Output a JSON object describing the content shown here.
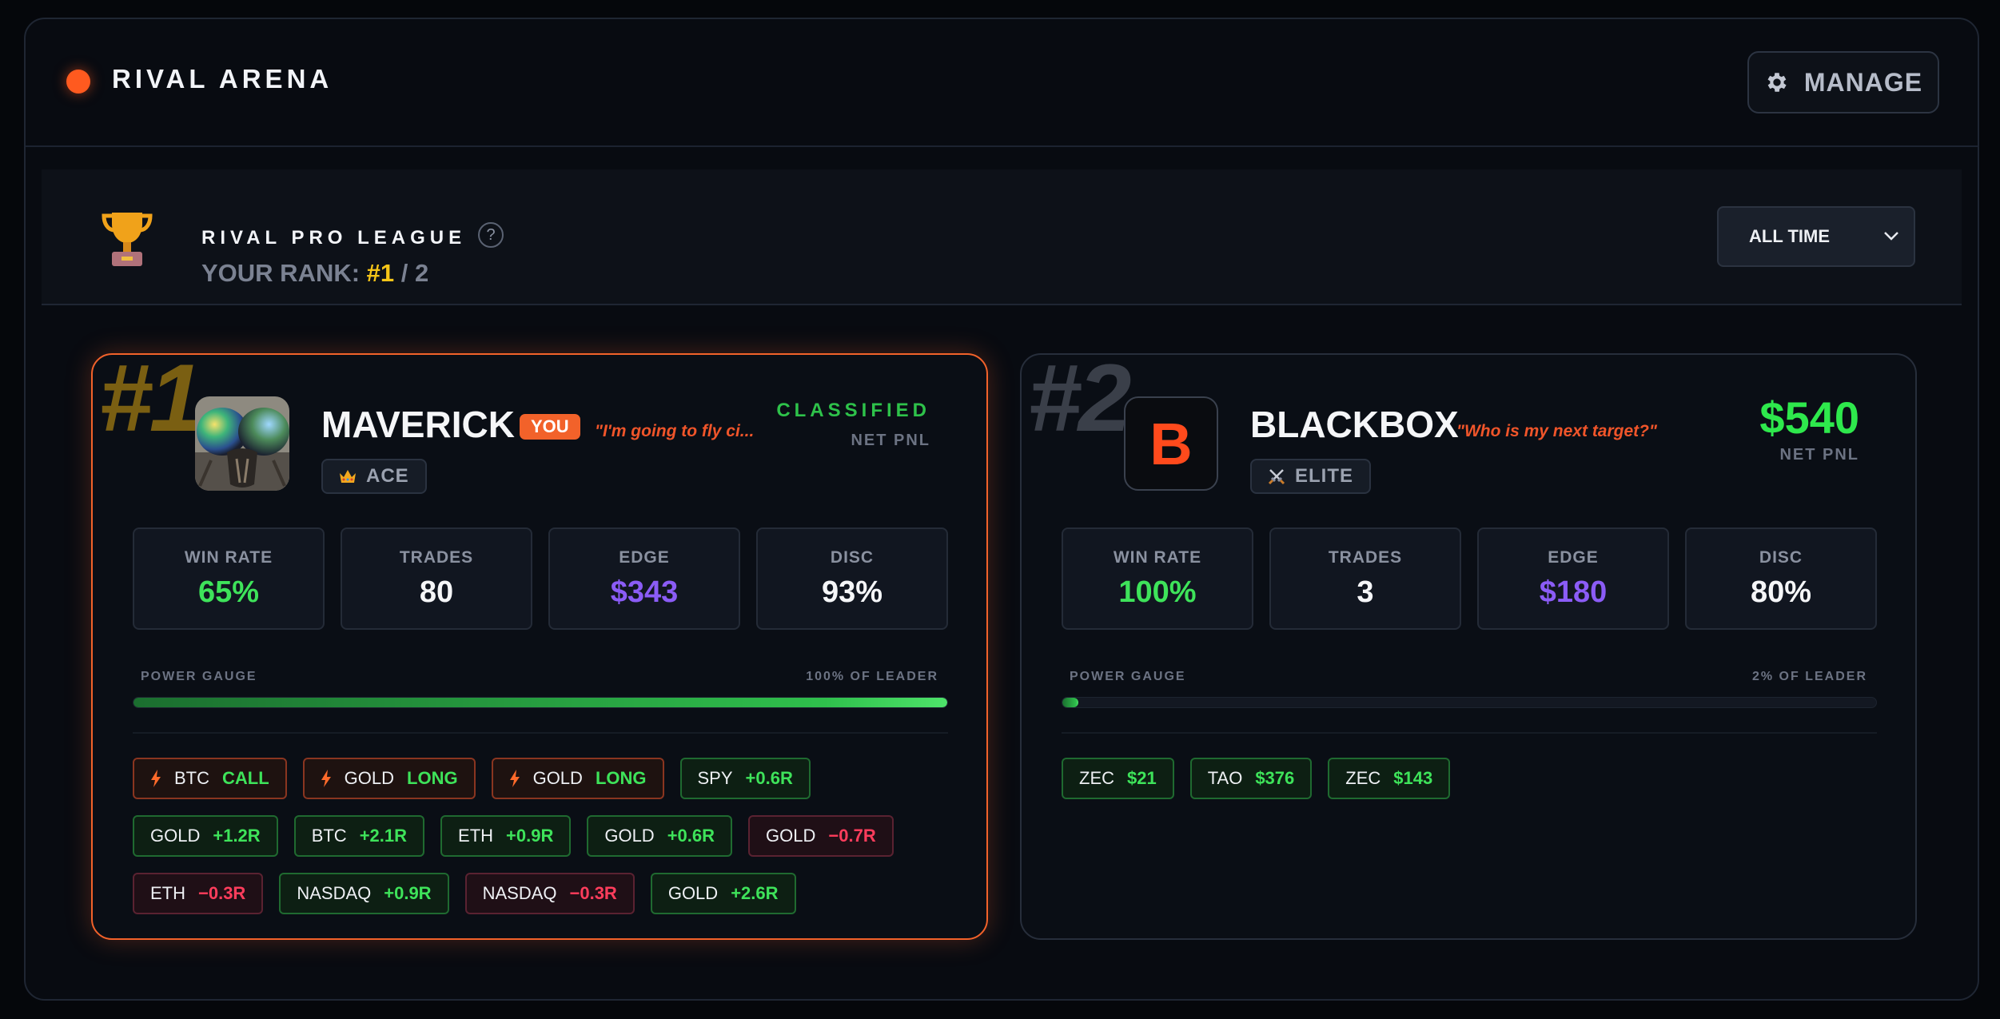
{
  "header": {
    "title": "RIVAL ARENA",
    "manage_label": "MANAGE"
  },
  "league": {
    "name": "RIVAL PRO LEAGUE",
    "help": "?",
    "rank_prefix": "YOUR RANK: ",
    "rank": "#1",
    "rank_total": " / 2",
    "time_filter": "ALL TIME"
  },
  "colors": {
    "accent": "#f2622a",
    "positive": "#3ee35a",
    "negative": "#ff3d5c",
    "edge": "#8b5cf6",
    "rank": "#f5c518"
  },
  "cards": [
    {
      "rank": "#1",
      "name": "MAVERICK",
      "you_badge": "YOU",
      "quote": "\"I'm going to fly ci...",
      "tier": "ACE",
      "tier_icon": "crown-icon",
      "pnl": "CLASSIFIED",
      "pnl_label": "NET PNL",
      "stats": [
        {
          "label": "WIN RATE",
          "value": "65%"
        },
        {
          "label": "TRADES",
          "value": "80"
        },
        {
          "label": "EDGE",
          "value": "$343"
        },
        {
          "label": "DISC",
          "value": "93%"
        }
      ],
      "gauge_label": "POWER GAUGE",
      "gauge_pct_label": "100% OF LEADER",
      "gauge_value": 100,
      "live_positions": [
        {
          "symbol": "BTC",
          "result": "CALL"
        },
        {
          "symbol": "GOLD",
          "result": "LONG"
        },
        {
          "symbol": "GOLD",
          "result": "LONG"
        }
      ],
      "trades": [
        {
          "symbol": "SPY",
          "result": "+0.6R",
          "type": "pos"
        },
        {
          "symbol": "GOLD",
          "result": "+1.2R",
          "type": "pos"
        },
        {
          "symbol": "BTC",
          "result": "+2.1R",
          "type": "pos"
        },
        {
          "symbol": "ETH",
          "result": "+0.9R",
          "type": "pos"
        },
        {
          "symbol": "GOLD",
          "result": "+0.6R",
          "type": "pos"
        },
        {
          "symbol": "GOLD",
          "result": "−0.7R",
          "type": "neg"
        },
        {
          "symbol": "ETH",
          "result": "−0.3R",
          "type": "neg"
        },
        {
          "symbol": "NASDAQ",
          "result": "+0.9R",
          "type": "pos"
        },
        {
          "symbol": "NASDAQ",
          "result": "−0.3R",
          "type": "neg"
        },
        {
          "symbol": "GOLD",
          "result": "+2.6R",
          "type": "pos"
        }
      ]
    },
    {
      "rank": "#2",
      "name": "BLACKBOX",
      "avatar_letter": "B",
      "quote": "\"Who is my next target?\"",
      "tier": "ELITE",
      "tier_icon": "crossed-swords-icon",
      "pnl": "$540",
      "pnl_label": "NET PNL",
      "stats": [
        {
          "label": "WIN RATE",
          "value": "100%"
        },
        {
          "label": "TRADES",
          "value": "3"
        },
        {
          "label": "EDGE",
          "value": "$180"
        },
        {
          "label": "DISC",
          "value": "80%"
        }
      ],
      "gauge_label": "POWER GAUGE",
      "gauge_pct_label": "2% OF LEADER",
      "gauge_value": 2,
      "trades": [
        {
          "symbol": "ZEC",
          "result": "$21",
          "type": "pos"
        },
        {
          "symbol": "TAO",
          "result": "$376",
          "type": "pos"
        },
        {
          "symbol": "ZEC",
          "result": "$143",
          "type": "pos"
        }
      ]
    }
  ]
}
